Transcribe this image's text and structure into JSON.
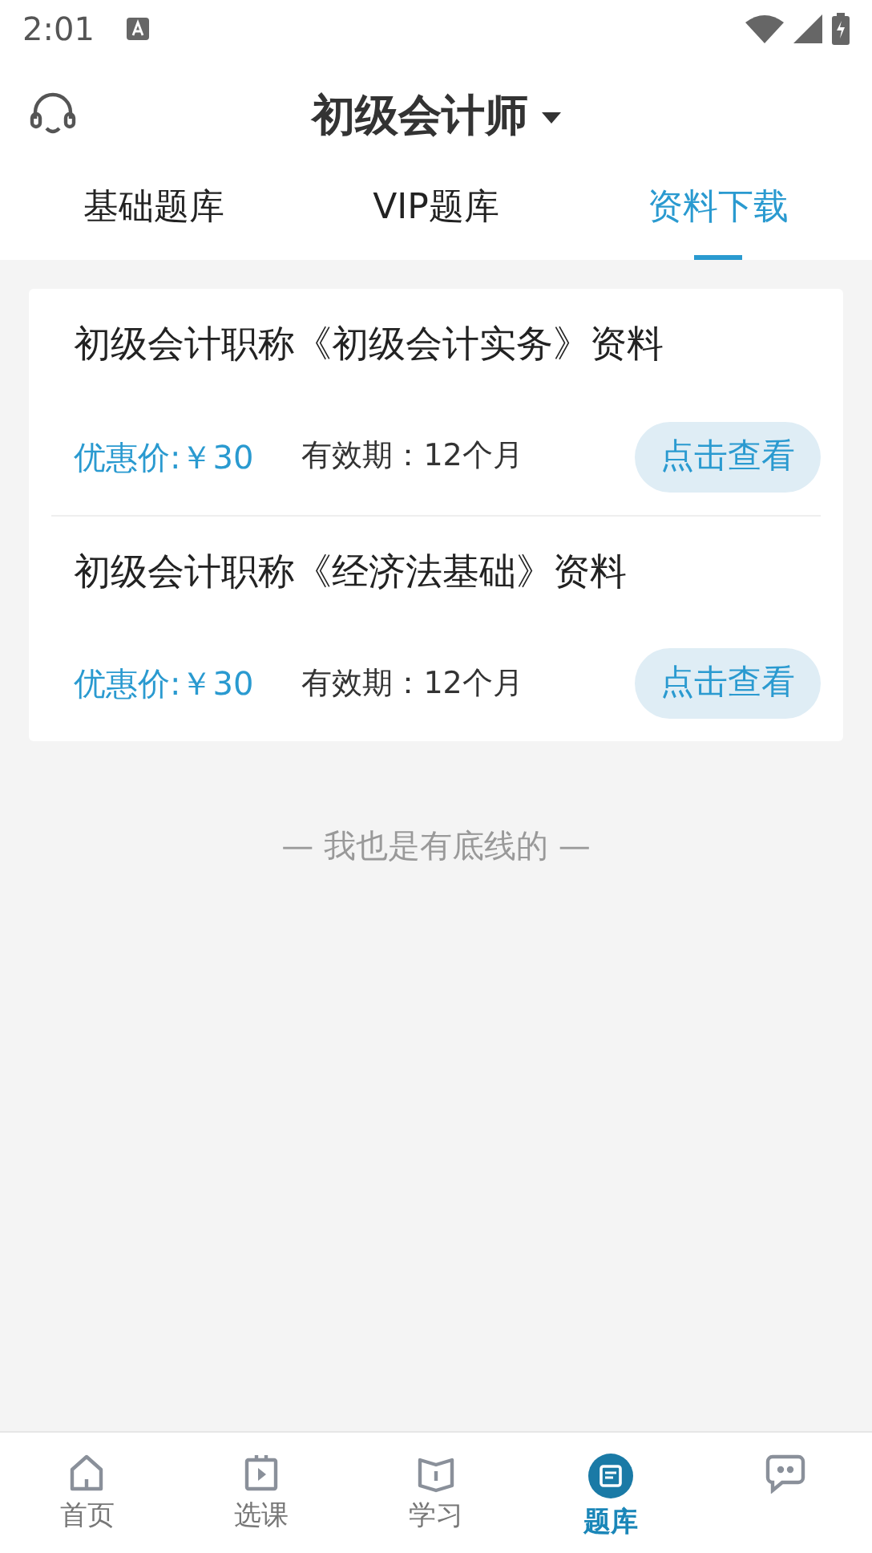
{
  "status_bar": {
    "time": "2:01"
  },
  "header": {
    "title": "初级会计师"
  },
  "tabs": [
    {
      "label": "基础题库",
      "selected": false
    },
    {
      "label": "VIP题库",
      "selected": false
    },
    {
      "label": "资料下载",
      "selected": true
    }
  ],
  "materials": [
    {
      "title": "初级会计职称《初级会计实务》资料",
      "price": "优惠价:￥30",
      "validity": "有效期：12个月",
      "button": "点击查看"
    },
    {
      "title": "初级会计职称《经济法基础》资料",
      "price": "优惠价:￥30",
      "validity": "有效期：12个月",
      "button": "点击查看"
    }
  ],
  "end_note": "— 我也是有底线的 —",
  "bottom_nav": [
    {
      "label": "首页",
      "selected": false
    },
    {
      "label": "选课",
      "selected": false
    },
    {
      "label": "学习",
      "selected": false
    },
    {
      "label": "题库",
      "selected": true
    },
    {
      "selected": false
    }
  ]
}
